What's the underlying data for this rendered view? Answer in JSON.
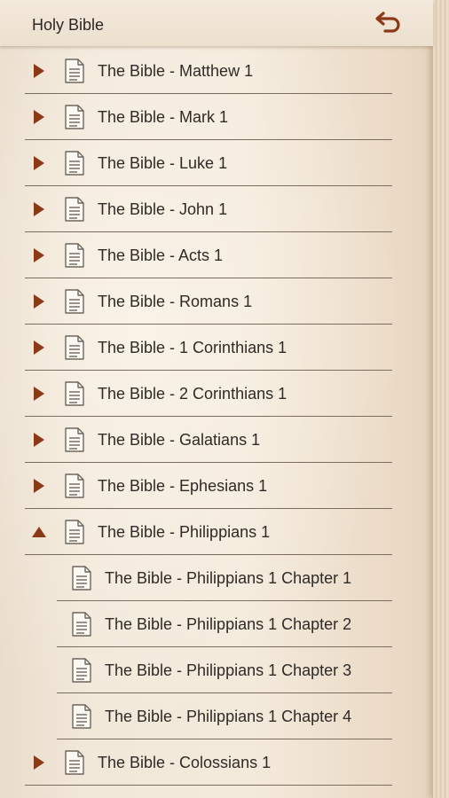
{
  "header": {
    "title": "Holy Bible",
    "back_icon": "undo-arrow-icon"
  },
  "colors": {
    "accent": "#8a3a16",
    "separator": "#7a6d60"
  },
  "list": {
    "items": [
      {
        "label": "The Bible - Matthew 1",
        "expanded": false
      },
      {
        "label": "The Bible - Mark 1",
        "expanded": false
      },
      {
        "label": "The Bible - Luke 1",
        "expanded": false
      },
      {
        "label": "The Bible - John 1",
        "expanded": false
      },
      {
        "label": "The Bible - Acts 1",
        "expanded": false
      },
      {
        "label": "The Bible - Romans 1",
        "expanded": false
      },
      {
        "label": "The Bible - 1 Corinthians 1",
        "expanded": false
      },
      {
        "label": "The Bible - 2 Corinthians 1",
        "expanded": false
      },
      {
        "label": "The Bible - Galatians 1",
        "expanded": false
      },
      {
        "label": "The Bible - Ephesians 1",
        "expanded": false
      },
      {
        "label": "The Bible - Philippians 1",
        "expanded": true
      },
      {
        "label": "The Bible - Philippians 1 Chapter 1",
        "child": true
      },
      {
        "label": "The Bible - Philippians 1 Chapter 2",
        "child": true
      },
      {
        "label": "The Bible - Philippians 1 Chapter 3",
        "child": true
      },
      {
        "label": "The Bible - Philippians 1 Chapter 4",
        "child": true
      },
      {
        "label": "The Bible - Colossians 1",
        "expanded": false
      }
    ]
  }
}
